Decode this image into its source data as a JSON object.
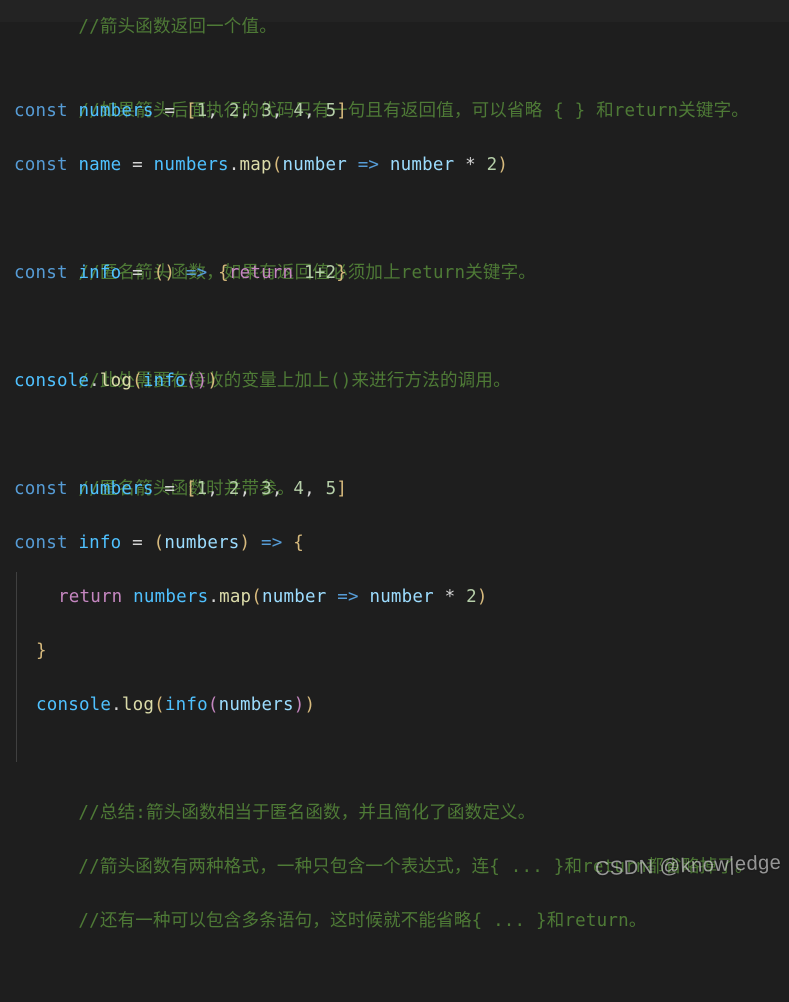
{
  "editor": {
    "background": "#1e1e1e",
    "comment_color": "#4e7a36",
    "keyword_color": "#569cd6",
    "variable_color": "#4fc1ff",
    "function_color": "#dcdcaa",
    "parameter_color": "#9cdcfe",
    "control_color": "#c586c0",
    "number_color": "#b5cea8",
    "bracket_color": "#d7ba7d"
  },
  "watermark": {
    "text": "CSDN @know|edge"
  },
  "lines": {
    "l1": "//箭头函数返回一个值。",
    "l2": "//如果箭头后面执行的代码只有一句且有返回值，可以省略 { } 和return关键字。",
    "l3": {
      "kw": "const",
      "name": "numbers",
      "eq": "=",
      "ob": "[",
      "n1": "1",
      "c1": ",",
      "n2": "2",
      "c2": ",",
      "n3": "3",
      "c3": ",",
      "n4": "4",
      "c4": ",",
      "n5": "5",
      "cb": "]"
    },
    "l4": {
      "kw": "const",
      "name": "name",
      "eq": "=",
      "obj": "numbers",
      "dot": ".",
      "fn": "map",
      "op": "(",
      "param": "number",
      "arrow": "=>",
      "body_var": "number",
      "star": "*",
      "num": "2",
      "cp": ")"
    },
    "l5": "//匿名箭头函数，如果有返回值必须加上return关键字。",
    "l6": {
      "kw": "const",
      "name": "info",
      "eq": "=",
      "parens": "()",
      "arrow": "=>",
      "ob": "{",
      "ret": "return",
      "expr": "1+2",
      "cb": "}"
    },
    "l7": "//此处需要在接收的变量上加上()来进行方法的调用。",
    "l8": {
      "obj": "console",
      "dot": ".",
      "fn": "log",
      "op": "(",
      "arg": "info",
      "inner": "()",
      "cp": ")"
    },
    "l9": "//匿名箭头函数时并带参。",
    "l10": {
      "kw": "const",
      "name": "numbers",
      "eq": "=",
      "ob": "[",
      "n1": "1",
      "c1": ",",
      "n2": "2",
      "c2": ",",
      "n3": "3",
      "c3": ",",
      "n4": "4",
      "c4": ",",
      "n5": "5",
      "cb": "]"
    },
    "l11": {
      "kw": "const",
      "name": "info",
      "eq": "=",
      "op": "(",
      "param": "numbers",
      "cp": ")",
      "arrow": "=>",
      "ob": "{"
    },
    "l12": {
      "ret": "return",
      "obj": "numbers",
      "dot": ".",
      "fn": "map",
      "op": "(",
      "param": "number",
      "arrow": "=>",
      "body_var": "number",
      "star": "*",
      "num": "2",
      "cp": ")"
    },
    "l13": {
      "cb": "}"
    },
    "l14": {
      "obj": "console",
      "dot": ".",
      "fn": "log",
      "op": "(",
      "arg": "info",
      "op2": "(",
      "arg2": "numbers",
      "cp2": ")",
      "cp": ")"
    },
    "l15": "//总结:箭头函数相当于匿名函数，并且简化了函数定义。",
    "l16": "//箭头函数有两种格式，一种只包含一个表达式，连{ ... }和return都省略掉了。",
    "l17": "//还有一种可以包含多条语句，这时候就不能省略{ ... }和return。"
  }
}
